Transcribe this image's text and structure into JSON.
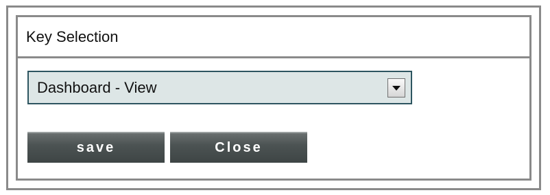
{
  "panel": {
    "title": "Key Selection"
  },
  "key_select": {
    "selected_value": "Dashboard - View"
  },
  "buttons": {
    "save_label": "save",
    "close_label": "Close"
  },
  "colors": {
    "frame_border": "#8a8a8a",
    "select_background": "#dde6e6",
    "select_border": "#2d5560",
    "button_background": "#4c5353",
    "button_text": "#ffffff"
  }
}
